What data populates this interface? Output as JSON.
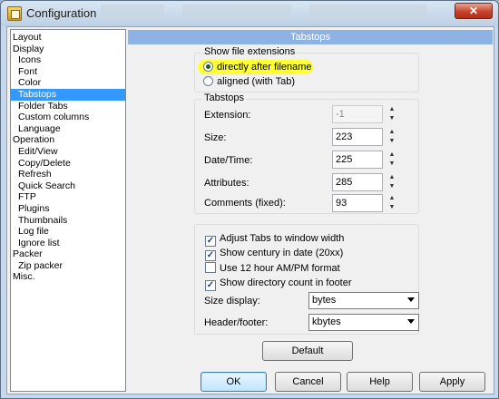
{
  "window": {
    "title": "Configuration",
    "close_glyph": "✕"
  },
  "tree": {
    "items": [
      {
        "label": "Layout",
        "level": 1
      },
      {
        "label": "Display",
        "level": 1
      },
      {
        "label": "Icons",
        "level": 2
      },
      {
        "label": "Font",
        "level": 2
      },
      {
        "label": "Color",
        "level": 2
      },
      {
        "label": "Tabstops",
        "level": 2,
        "selected": true
      },
      {
        "label": "Folder Tabs",
        "level": 2
      },
      {
        "label": "Custom columns",
        "level": 2
      },
      {
        "label": "Language",
        "level": 2
      },
      {
        "label": "Operation",
        "level": 1
      },
      {
        "label": "Edit/View",
        "level": 2
      },
      {
        "label": "Copy/Delete",
        "level": 2
      },
      {
        "label": "Refresh",
        "level": 2
      },
      {
        "label": "Quick Search",
        "level": 2
      },
      {
        "label": "FTP",
        "level": 2
      },
      {
        "label": "Plugins",
        "level": 2
      },
      {
        "label": "Thumbnails",
        "level": 2
      },
      {
        "label": "Log file",
        "level": 2
      },
      {
        "label": "Ignore list",
        "level": 2
      },
      {
        "label": "Packer",
        "level": 1
      },
      {
        "label": "Zip packer",
        "level": 2
      },
      {
        "label": "Misc.",
        "level": 1
      }
    ]
  },
  "panel": {
    "header": "Tabstops",
    "show_ext": {
      "label": "Show file extensions",
      "option1": "directly after filename",
      "option2": "aligned (with Tab)"
    },
    "tabstops": {
      "label": "Tabstops",
      "extension": {
        "label": "Extension:",
        "value": "-1"
      },
      "size": {
        "label": "Size:",
        "value": "223"
      },
      "datetime": {
        "label": "Date/Time:",
        "value": "225"
      },
      "attributes": {
        "label": "Attributes:",
        "value": "285"
      },
      "comments": {
        "label": "Comments (fixed):",
        "value": "93"
      }
    },
    "options": {
      "adjust_tabs": {
        "label": "Adjust Tabs to window width",
        "checked": true
      },
      "century": {
        "label": "Show century in date (20xx)",
        "checked": true
      },
      "ampm": {
        "label": "Use 12 hour AM/PM format",
        "checked": false
      },
      "dircount": {
        "label": "Show directory count in footer",
        "checked": true
      },
      "size_display": {
        "label": "Size display:",
        "value": "bytes"
      },
      "header_footer": {
        "label": "Header/footer:",
        "value": "kbytes"
      }
    },
    "default_button": "Default"
  },
  "buttons": {
    "ok": "OK",
    "cancel": "Cancel",
    "help": "Help",
    "apply": "Apply"
  },
  "colors": {
    "selection": "#3399ff",
    "header": "#8db2e3",
    "highlight": "#ffff33"
  }
}
